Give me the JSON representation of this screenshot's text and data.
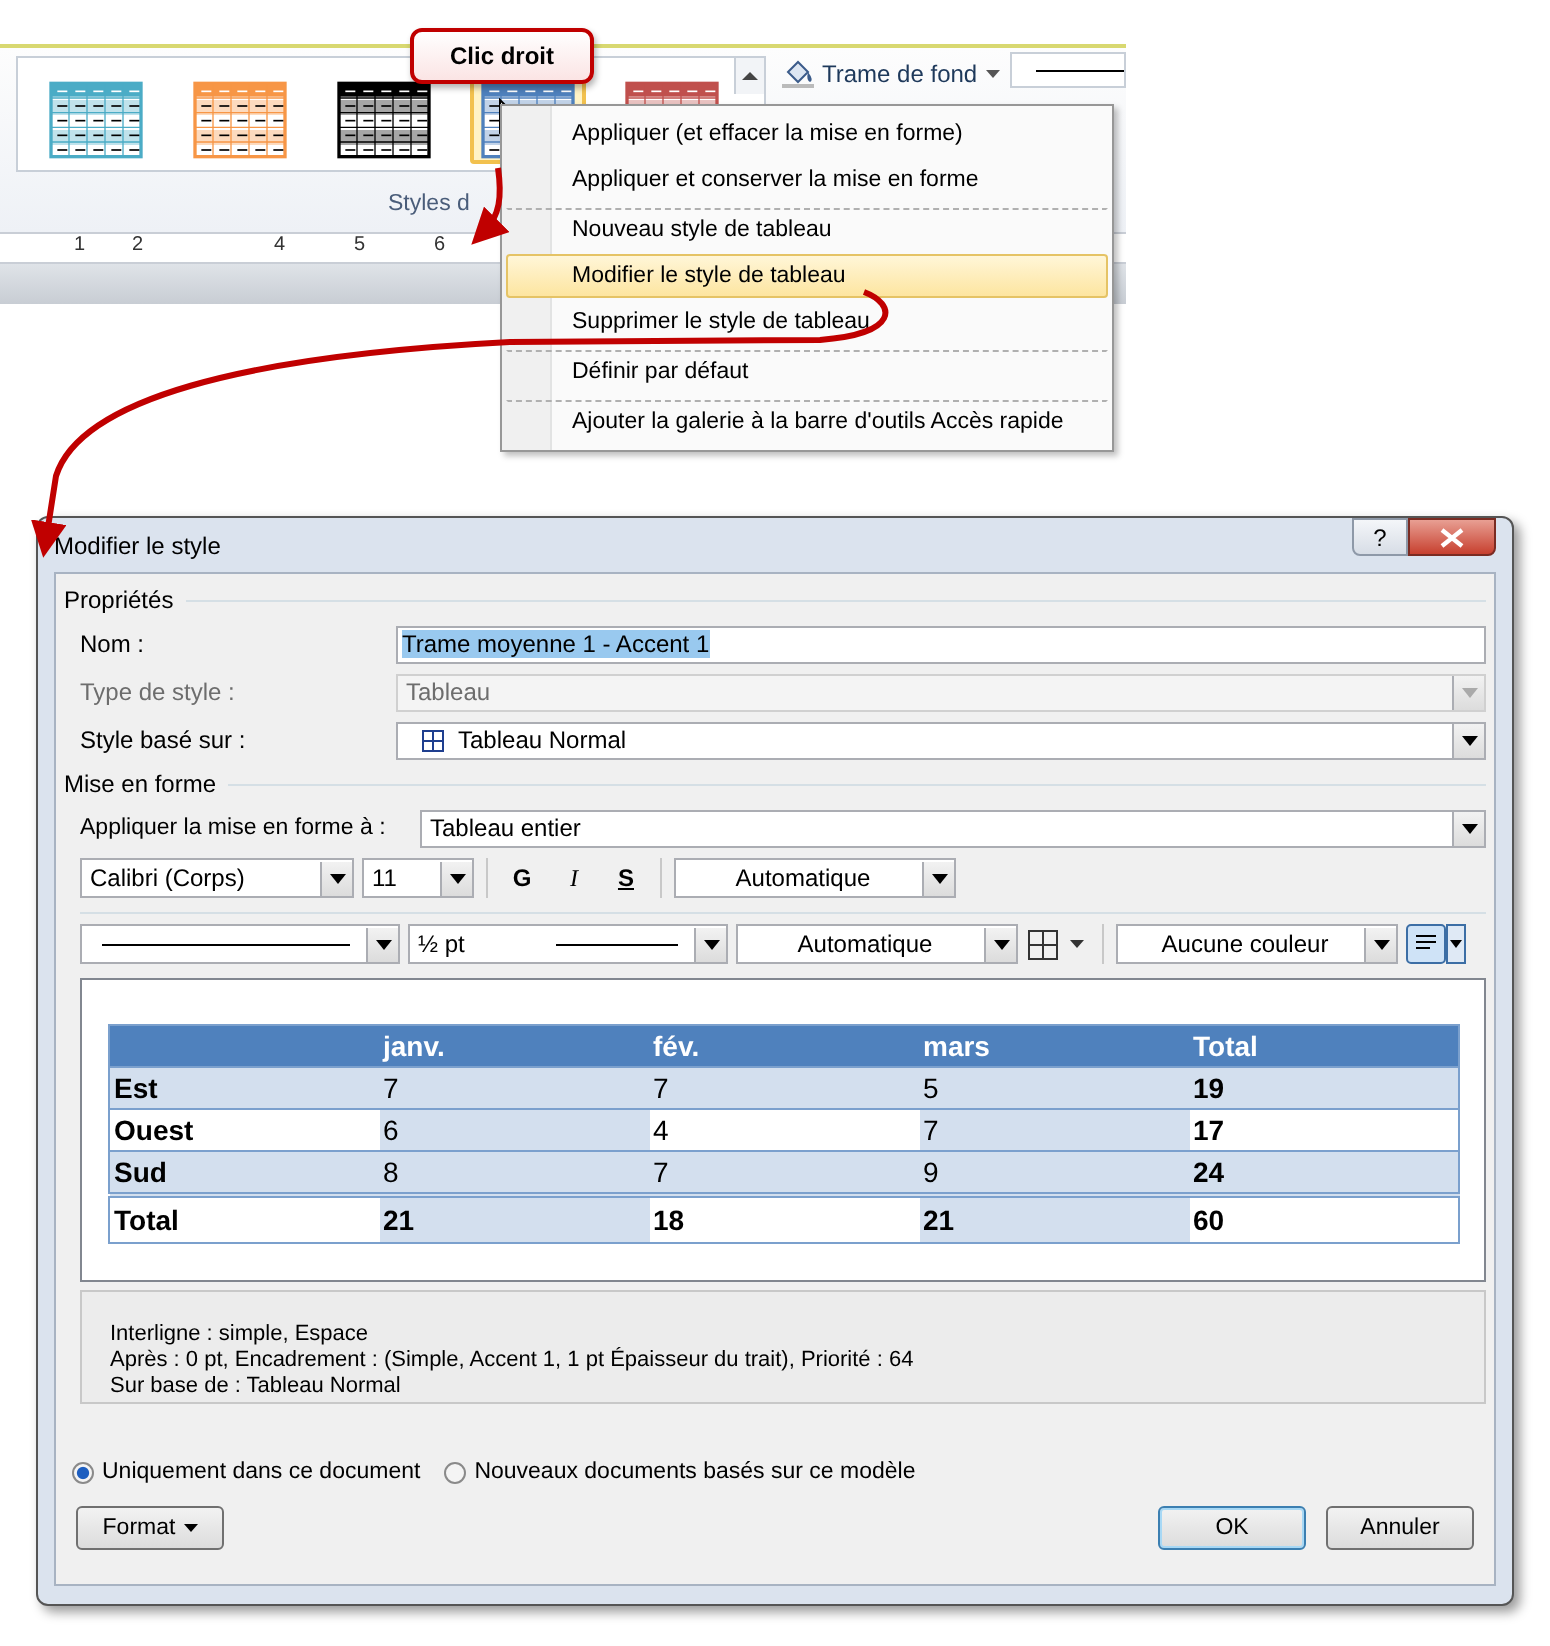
{
  "ribbon": {
    "gallery": [
      {
        "color": "#4bacc6",
        "selected": false
      },
      {
        "color": "#f79646",
        "selected": false
      },
      {
        "color": "#000000",
        "selected": false
      },
      {
        "color": "#4f81bd",
        "selected": true
      },
      {
        "color": "#c0504d",
        "selected": false
      }
    ],
    "group_label": "Styles d",
    "shading_button": "Trame de fond",
    "ruler": [
      "1",
      "2",
      "4",
      "5",
      "6"
    ]
  },
  "callout": "Clic droit",
  "context_menu": [
    {
      "label": "Appliquer (et effacer la mise en forme)",
      "selected": false,
      "separator_above": false
    },
    {
      "label": "Appliquer et conserver la mise en forme",
      "selected": false,
      "separator_above": false
    },
    {
      "label": "Nouveau style de tableau",
      "selected": false,
      "separator_above": true
    },
    {
      "label": "Modifier le style de tableau",
      "selected": true,
      "separator_above": false
    },
    {
      "label": "Supprimer le style de tableau",
      "selected": false,
      "separator_above": false
    },
    {
      "label": "Définir par défaut",
      "selected": false,
      "separator_above": true
    },
    {
      "label": "Ajouter la galerie à la barre d'outils Accès rapide",
      "selected": false,
      "separator_above": true
    }
  ],
  "dialog": {
    "title": "Modifier le style",
    "help": "?",
    "properties_heading": "Propriétés",
    "fields": [
      {
        "label": "Nom :",
        "value": "Trame moyenne 1 - Accent 1",
        "kind": "text",
        "disabled": false
      },
      {
        "label": "Type de style :",
        "value": "Tableau",
        "kind": "select",
        "disabled": true
      },
      {
        "label": "Style basé sur :",
        "value": "Tableau Normal",
        "kind": "select",
        "disabled": false
      }
    ],
    "formatting_heading": "Mise en forme",
    "apply_to": {
      "label": "Appliquer la mise en forme à :",
      "value": "Tableau entier"
    },
    "font": "Calibri (Corps)",
    "size": "11",
    "bold": "G",
    "italic": "I",
    "underline": "S",
    "font_color": "Automatique",
    "line_weight": "½ pt",
    "border_color": "Automatique",
    "shading": "Aucune couleur",
    "preview": {
      "columns": [
        "",
        "janv.",
        "fév.",
        "mars",
        "Total"
      ],
      "rows": [
        {
          "cells": [
            "Est",
            "7",
            "7",
            "5",
            "19"
          ],
          "banded": true,
          "kind": "data"
        },
        {
          "cells": [
            "Ouest",
            "6",
            "4",
            "7",
            "17"
          ],
          "banded": false,
          "kind": "data"
        },
        {
          "cells": [
            "Sud",
            "8",
            "7",
            "9",
            "24"
          ],
          "banded": true,
          "kind": "data"
        },
        {
          "cells": [
            "Total",
            "21",
            "18",
            "21",
            "60"
          ],
          "banded": false,
          "kind": "total"
        }
      ]
    },
    "description": [
      "Interligne : simple, Espace",
      "Après : 0 pt, Encadrement : (Simple, Accent 1,  1 pt Épaisseur du trait), Priorité : 64",
      "Sur base de : Tableau Normal"
    ],
    "scope": [
      {
        "label": "Uniquement dans ce document",
        "selected": true
      },
      {
        "label": "Nouveaux documents basés sur ce modèle",
        "selected": false
      }
    ],
    "format_button": "Format",
    "ok": "OK",
    "cancel": "Annuler"
  }
}
